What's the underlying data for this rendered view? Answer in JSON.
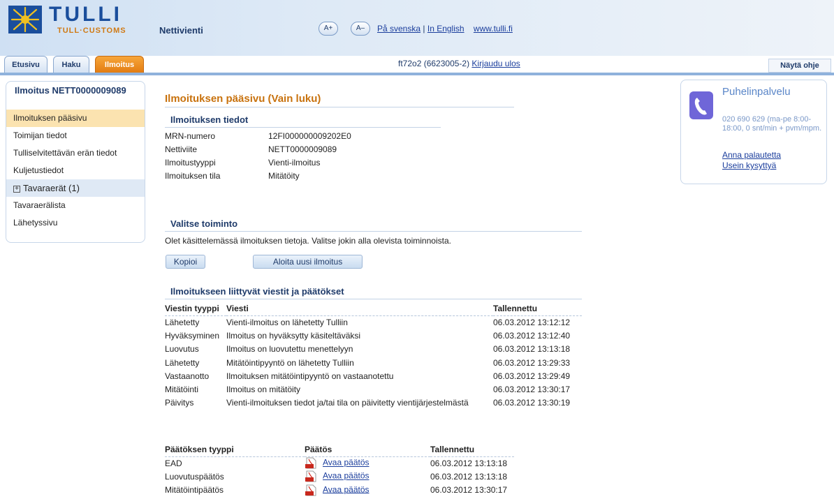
{
  "header": {
    "logo_text": "TULLI",
    "logo_sub": "TULL·CUSTOMS",
    "app_name": "Nettivienti",
    "font_increase": "A+",
    "font_decrease": "A–",
    "lang_swedish": "På svenska",
    "lang_english": "In English",
    "site_link": "www.tulli.fi",
    "separator": "|"
  },
  "tabs": [
    {
      "label": "Etusivu",
      "active": false
    },
    {
      "label": "Haku",
      "active": false
    },
    {
      "label": "Ilmoitus",
      "active": true
    }
  ],
  "user": {
    "id": "ft72o2 (6623005-2)",
    "logout": "Kirjaudu ulos"
  },
  "help_button": "Näytä ohje",
  "sidebar": {
    "title": "Ilmoitus NETT0000009089",
    "items": [
      {
        "label": "Ilmoituksen pääsivu",
        "selected": true
      },
      {
        "label": "Toimijan tiedot"
      },
      {
        "label": "Tulliselvitettävän erän tiedot"
      },
      {
        "label": "Kuljetustiedot"
      },
      {
        "label": "Tavaraerät (1)",
        "expand": "+"
      },
      {
        "label": "Tavaraerälista"
      },
      {
        "label": "Lähetyssivu"
      }
    ]
  },
  "main": {
    "title": "Ilmoituksen pääsivu  (Vain luku)",
    "details_heading": "Ilmoituksen tiedot",
    "details": [
      {
        "key": "MRN-numero",
        "value": "12FI000000009202E0"
      },
      {
        "key": "Nettiviite",
        "value": "NETT0000009089"
      },
      {
        "key": "Ilmoitustyyppi",
        "value": "Vienti-ilmoitus"
      },
      {
        "key": "Ilmoituksen tila",
        "value": "Mitätöity"
      }
    ],
    "action_heading": "Valitse toiminto",
    "action_text": "Olet käsittelemässä ilmoituksen tietoja. Valitse jokin alla olevista toiminnoista.",
    "copy_button": "Kopioi",
    "new_button": "Aloita uusi ilmoitus",
    "messages_heading": "Ilmoitukseen liittyvät viestit ja päätökset",
    "messages_columns": [
      "Viestin tyyppi",
      "Viesti",
      "Tallennettu"
    ],
    "messages": [
      [
        "Lähetetty",
        "Vienti-ilmoitus on lähetetty Tulliin",
        "06.03.2012 13:12:12"
      ],
      [
        "Hyväksyminen",
        "Ilmoitus on hyväksytty käsiteltäväksi",
        "06.03.2012 13:12:40"
      ],
      [
        "Luovutus",
        "Ilmoitus on luovutettu menettelyyn",
        "06.03.2012 13:13:18"
      ],
      [
        "Lähetetty",
        "Mitätöintipyyntö on lähetetty Tulliin",
        "06.03.2012 13:29:33"
      ],
      [
        "Vastaanotto",
        "Ilmoituksen mitätöintipyyntö on vastaanotettu",
        "06.03.2012 13:29:49"
      ],
      [
        "Mitätöinti",
        "Ilmoitus on mitätöity",
        "06.03.2012 13:30:17"
      ],
      [
        "Päivitys",
        "Vienti-ilmoituksen tiedot ja/tai tila on päivitetty vientijärjestelmästä",
        "06.03.2012 13:30:19"
      ]
    ],
    "decisions_columns": [
      "Päätöksen tyyppi",
      "Päätös",
      "Tallennettu"
    ],
    "decisions": [
      [
        "EAD",
        "Avaa päätös",
        "06.03.2012 13:13:18"
      ],
      [
        "Luovutuspäätös",
        "Avaa päätös",
        "06.03.2012 13:13:18"
      ],
      [
        "Mitätöintipäätös",
        "Avaa päätös",
        "06.03.2012 13:30:17"
      ]
    ]
  },
  "phone_panel": {
    "title": "Puhelinpalvelu",
    "text": "020 690 629 (ma-pe 8:00-18:00, 0 snt/min + pvm/mpm.",
    "feedback_link": "Anna palautetta",
    "faq_link": "Usein kysyttyä"
  },
  "colors": {
    "accent_orange": "#e27a10",
    "brand_blue": "#1a4e9c",
    "title_orange": "#c8720e"
  }
}
